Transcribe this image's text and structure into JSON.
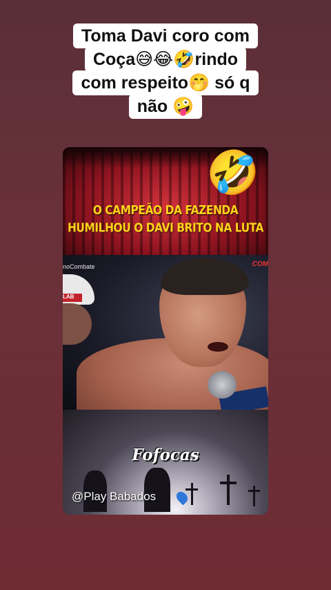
{
  "caption": {
    "lines": [
      "Toma Davi coro com",
      "Coça😅😂🤣rindo",
      "com respeito🤭 só q",
      "não 🤪"
    ]
  },
  "card": {
    "headline": [
      "O CAMPEÃO DA FAZENDA",
      "HUMILHOU O DAVI BRITO NA LUTA"
    ],
    "reaction_emoji": "🤣",
    "video_label": "noCombate",
    "video_logo": "COM",
    "cap_text": "LAB",
    "watermark_title": "Fofocas",
    "handle": "@Play Babados"
  }
}
